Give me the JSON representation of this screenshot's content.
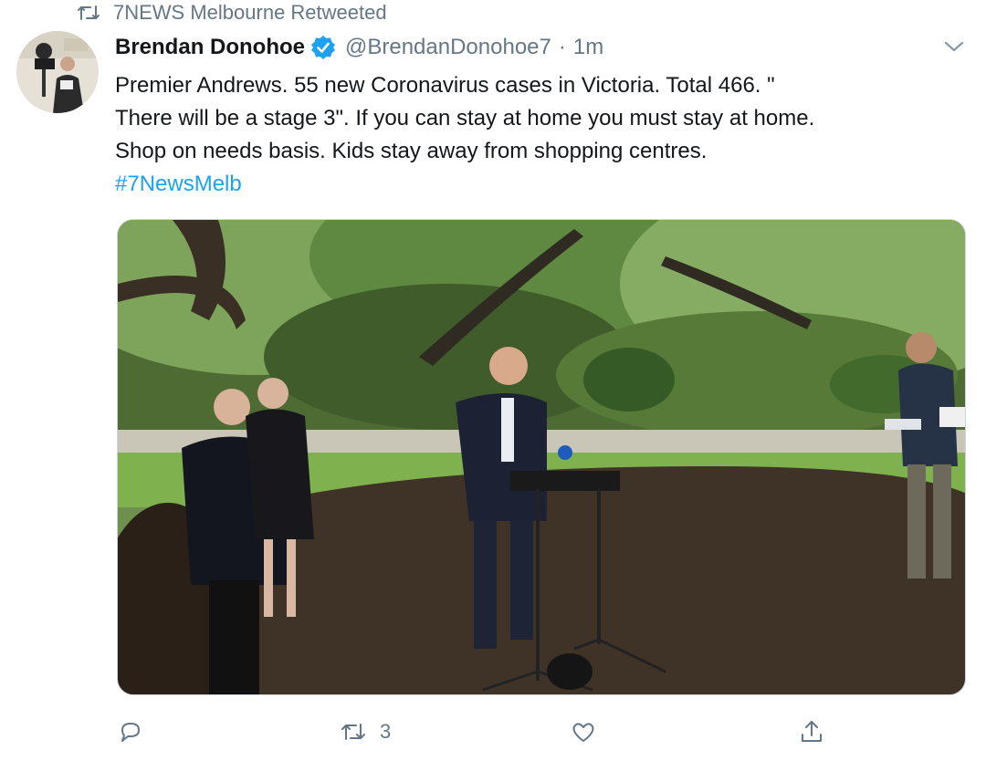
{
  "context": {
    "icon": "retweet-icon",
    "text": "7NEWS Melbourne Retweeted"
  },
  "author": {
    "display_name": "Brendan Donohoe",
    "verified_icon": "verified-badge-icon",
    "handle": "@BrendanDonohoe7",
    "separator": "·",
    "time": "1m"
  },
  "tweet": {
    "lines": [
      "Premier Andrews. 55 new Coronavirus cases in Victoria. Total 466. \"",
      "There will be a stage 3\". If you can stay at home you must stay at home.",
      "Shop on needs basis. Kids stay away from shopping centres."
    ],
    "hashtag": "#7NewsMelb"
  },
  "actions": {
    "reply": {
      "icon": "reply-icon",
      "count": ""
    },
    "retweet": {
      "icon": "retweet-icon",
      "count": "3"
    },
    "like": {
      "icon": "heart-icon",
      "count": ""
    },
    "share": {
      "icon": "share-icon",
      "count": ""
    }
  },
  "colors": {
    "link": "#1da1f2",
    "muted": "#657786",
    "text": "#14171a",
    "verified": "#1da1f2"
  }
}
